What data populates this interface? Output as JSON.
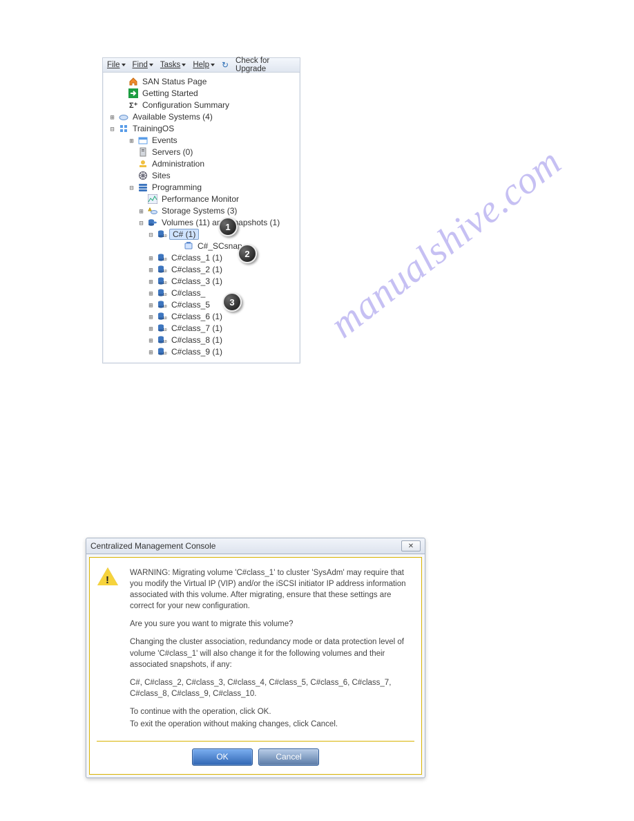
{
  "watermark": "manualshive.com",
  "menu": {
    "file": "File",
    "find": "Find",
    "tasks": "Tasks",
    "help": "Help",
    "upgrade": "Check for Upgrade"
  },
  "tree": {
    "san_status": "SAN Status Page",
    "getting_started": "Getting Started",
    "config_summary": "Configuration Summary",
    "available_systems": "Available Systems (4)",
    "trainingos": "TrainingOS",
    "events": "Events",
    "servers": "Servers (0)",
    "administration": "Administration",
    "sites": "Sites",
    "programming": "Programming",
    "perf_monitor": "Performance Monitor",
    "storage_systems": "Storage Systems (3)",
    "volumes_and_snapshots": "Volumes (11) and Snapshots (1)",
    "csharp": "C# (1)",
    "csharp_scsnap": "C#_SCsnap",
    "class1": "C#class_1 (1)",
    "class2": "C#class_2 (1)",
    "class3": "C#class_3 (1)",
    "class45": "C#class_",
    "class5b": "C#class_5",
    "class6": "C#class_6 (1)",
    "class7": "C#class_7 (1)",
    "class8": "C#class_8 (1)",
    "class9": "C#class_9 (1)"
  },
  "bullets": {
    "one": "1",
    "two": "2",
    "three": "3"
  },
  "dialog": {
    "title": "Centralized Management Console",
    "close_label": "✕",
    "warning": "WARNING: Migrating volume 'C#class_1' to cluster 'SysAdm' may require that you modify the Virtual IP (VIP) and/or the iSCSI initiator IP address information associated with this volume. After migrating, ensure that these settings are correct for your new configuration.",
    "are_you_sure": "Are you sure you want to migrate this volume?",
    "changing_intro": "Changing the cluster association, redundancy mode or data protection level of volume 'C#class_1' will also change it for the following volumes and their associated snapshots, if any:",
    "volumes_list": "C#, C#class_2, C#class_3, C#class_4, C#class_5, C#class_6, C#class_7, C#class_8, C#class_9, C#class_10.",
    "continue_line": "To continue with the operation, click OK.",
    "exit_line": "To exit the operation without making changes, click Cancel.",
    "ok": "OK",
    "cancel": "Cancel"
  }
}
